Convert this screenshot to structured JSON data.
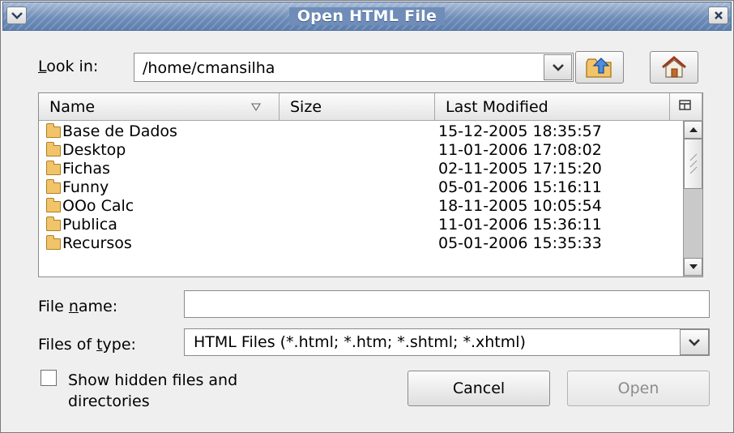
{
  "titlebar": {
    "title": "Open HTML File",
    "menu_icon": "chevron-down-icon",
    "close_icon": "close-icon"
  },
  "lookin": {
    "label_underlined": "L",
    "label_rest": "ook in:",
    "path": "/home/cmansilha",
    "up_icon": "folder-up-icon",
    "home_icon": "home-icon"
  },
  "filelist": {
    "columns": {
      "name": "Name",
      "size": "Size",
      "modified": "Last Modified"
    },
    "rows": [
      {
        "name": "Base de Dados",
        "modified": "15-12-2005 18:35:57"
      },
      {
        "name": "Desktop",
        "modified": "11-01-2006 17:08:02"
      },
      {
        "name": "Fichas",
        "modified": "02-11-2005 17:15:20"
      },
      {
        "name": "Funny",
        "modified": "05-01-2006 15:16:11"
      },
      {
        "name": "OOo Calc",
        "modified": "18-11-2005 10:05:54"
      },
      {
        "name": "Publica",
        "modified": "11-01-2006 15:36:11"
      },
      {
        "name": "Recursos",
        "modified": "05-01-2006 15:35:33"
      }
    ]
  },
  "filename": {
    "label_pre": "File ",
    "label_underlined": "n",
    "label_post": "ame:",
    "value": ""
  },
  "filetype": {
    "label_pre": "Files of ",
    "label_underlined": "t",
    "label_post": "ype:",
    "selected": "HTML Files (*.html; *.htm; *.shtml; *.xhtml)"
  },
  "hidden": {
    "label_line1": "Show hidden files and",
    "label_line2": "directories",
    "checked": false
  },
  "buttons": {
    "cancel": "Cancel",
    "open": "Open"
  },
  "colors": {
    "titlebar": "#6f8db8",
    "dialog_bg": "#efefef",
    "folder": "#f2c46a",
    "disabled_text": "#8c8c8c"
  }
}
